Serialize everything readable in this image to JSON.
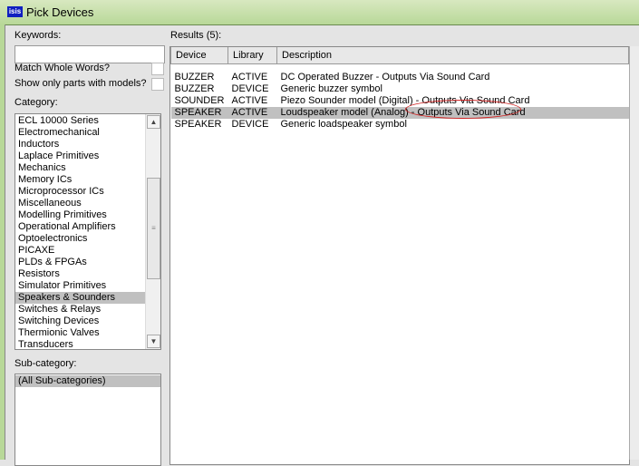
{
  "window": {
    "title": "Pick Devices",
    "logo": "isis"
  },
  "keywords": {
    "label": "Keywords:",
    "value": ""
  },
  "match_whole_words": {
    "label": "Match Whole Words?",
    "checked": false
  },
  "show_models": {
    "label": "Show only parts with models?",
    "checked": false
  },
  "category": {
    "label": "Category:",
    "items": [
      "ECL 10000 Series",
      "Electromechanical",
      "Inductors",
      "Laplace Primitives",
      "Mechanics",
      "Memory ICs",
      "Microprocessor ICs",
      "Miscellaneous",
      "Modelling Primitives",
      "Operational Amplifiers",
      "Optoelectronics",
      "PICAXE",
      "PLDs & FPGAs",
      "Resistors",
      "Simulator Primitives",
      "Speakers & Sounders",
      "Switches & Relays",
      "Switching Devices",
      "Thermionic Valves",
      "Transducers"
    ],
    "selected": "Speakers & Sounders"
  },
  "subcategory": {
    "label": "Sub-category:",
    "items": [
      "(All Sub-categories)"
    ]
  },
  "results": {
    "label": "Results (5):",
    "columns": [
      "Device",
      "Library",
      "Description"
    ],
    "rows": [
      [
        "BUZZER",
        "ACTIVE",
        "DC Operated Buzzer - Outputs Via Sound Card"
      ],
      [
        "BUZZER",
        "DEVICE",
        "Generic buzzer symbol"
      ],
      [
        "SOUNDER",
        "ACTIVE",
        "Piezo Sounder model (Digital) - Outputs Via Sound Card"
      ],
      [
        "SPEAKER",
        "ACTIVE",
        "Loudspeaker model (Analog) - Outputs Via Sound Card"
      ],
      [
        "SPEAKER",
        "DEVICE",
        "Generic loadspeaker symbol"
      ]
    ],
    "selected_row": 3
  },
  "colors": {
    "highlight": "#c0c0c0",
    "annotation": "#d02020"
  }
}
